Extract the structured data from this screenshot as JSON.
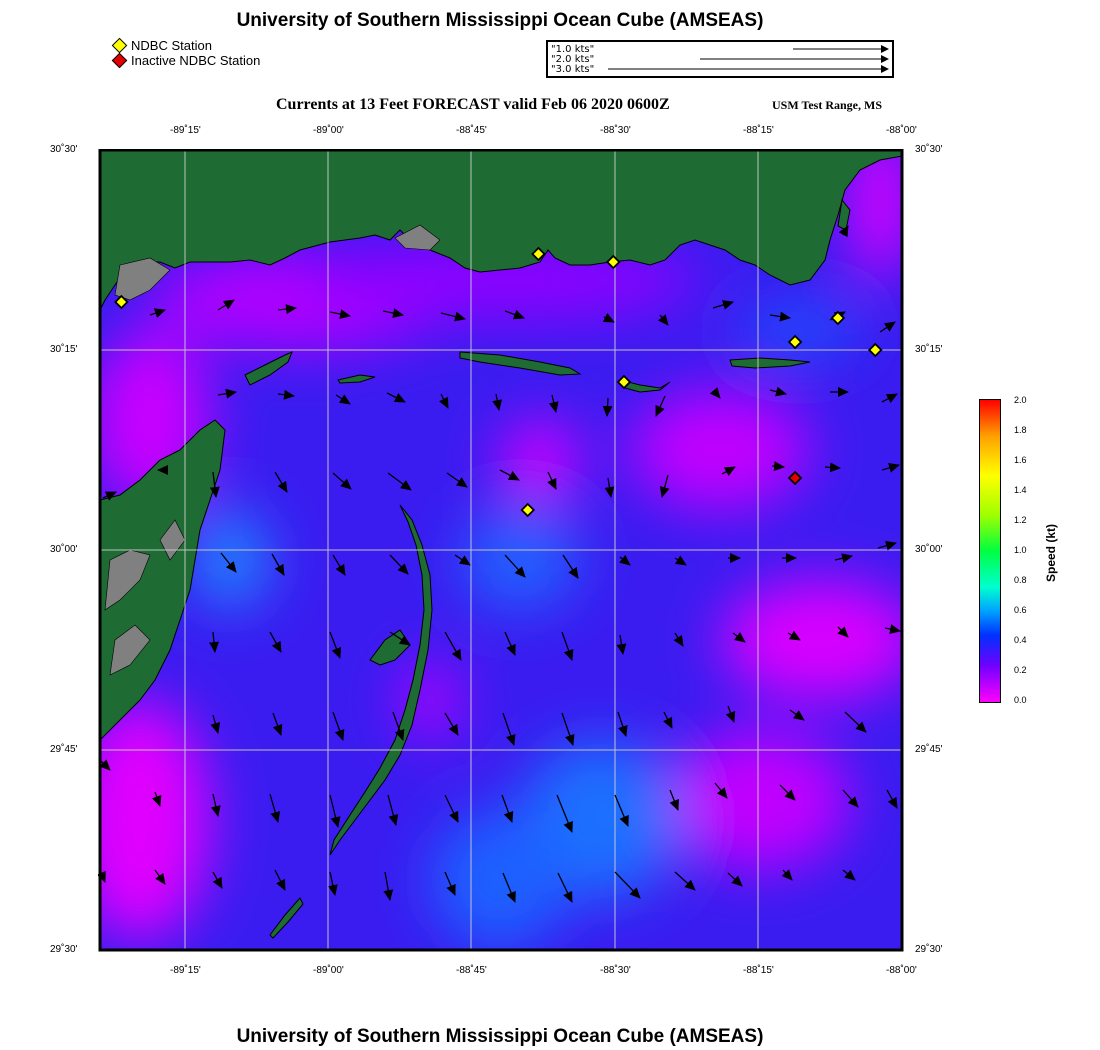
{
  "title": "University of Southern Mississippi Ocean Cube (AMSEAS)",
  "footer_title": "University of Southern Mississippi Ocean Cube (AMSEAS)",
  "subtitle": "Currents at 13 Feet FORECAST valid Feb 06 2020 0600Z",
  "region": "USM Test Range, MS",
  "legend": {
    "active_label": "NDBC Station",
    "active_color": "#ffff00",
    "inactive_label": "Inactive NDBC Station",
    "inactive_color": "#e00000"
  },
  "vector_scale": [
    {
      "label": "1.0 kts"
    },
    {
      "label": "2.0 kts"
    },
    {
      "label": "3.0 kts"
    }
  ],
  "map": {
    "lon_range": [
      -89.5,
      -88.0
    ],
    "lat_range": [
      29.5,
      30.5
    ],
    "lon_ticks": [
      "-89˚15'",
      "-89˚00'",
      "-88˚45'",
      "-88˚30'",
      "-88˚15'",
      "-88˚00'"
    ],
    "lat_ticks": [
      "30˚30'",
      "30˚15'",
      "30˚00'",
      "29˚45'",
      "29˚30'"
    ],
    "stations_active": [
      {
        "lon": -89.46,
        "lat": 30.31
      },
      {
        "lon": -88.68,
        "lat": 30.37
      },
      {
        "lon": -88.54,
        "lat": 30.36
      },
      {
        "lon": -88.52,
        "lat": 30.21
      },
      {
        "lon": -88.7,
        "lat": 30.05
      },
      {
        "lon": -88.2,
        "lat": 30.26
      },
      {
        "lon": -88.12,
        "lat": 30.29
      },
      {
        "lon": -88.05,
        "lat": 30.25
      }
    ],
    "stations_inactive": [
      {
        "lon": -88.2,
        "lat": 30.09
      }
    ]
  },
  "colorbar": {
    "label": "Speed (kt)",
    "ticks": [
      "0.0",
      "0.2",
      "0.4",
      "0.6",
      "0.8",
      "1.0",
      "1.2",
      "1.4",
      "1.6",
      "1.8",
      "2.0"
    ],
    "colors": [
      "#ff00ff",
      "#7000ff",
      "#0030ff",
      "#00a0ff",
      "#00ffd0",
      "#00ff40",
      "#a0ff00",
      "#ffff00",
      "#ffa000",
      "#ff3000",
      "#ff0000"
    ]
  },
  "colors": {
    "land": "#1e6b34",
    "grid": "#d0d0d0",
    "arrow": "#000000"
  }
}
